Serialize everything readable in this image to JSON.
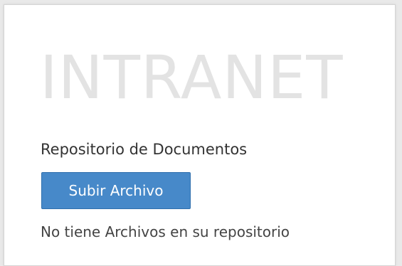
{
  "header": {
    "brand": "INTRANET"
  },
  "repository": {
    "title": "Repositorio de Documentos",
    "upload_button_label": "Subir Archivo",
    "empty_message": "No tiene Archivos en su repositorio"
  },
  "colors": {
    "button_primary": "#4789c9",
    "brand_text": "#e3e3e3"
  }
}
